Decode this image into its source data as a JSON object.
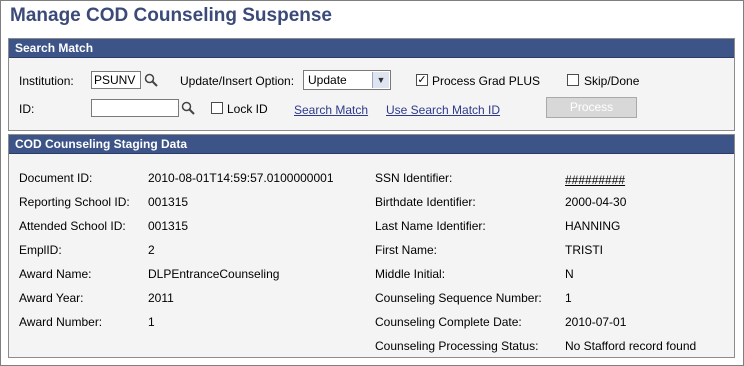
{
  "page": {
    "title": "Manage COD Counseling Suspense"
  },
  "search_match": {
    "header": "Search Match",
    "institution_label": "Institution:",
    "institution_value": "PSUNV",
    "update_option_label": "Update/Insert Option:",
    "update_option_value": "Update",
    "process_grad_plus_label": "Process Grad PLUS",
    "process_grad_plus_checked": "✓",
    "skip_done_label": "Skip/Done",
    "id_label": "ID:",
    "id_value": "",
    "lock_id_label": "Lock ID",
    "search_match_link": "Search Match",
    "use_search_match_id_link": "Use Search Match ID",
    "process_button": "Process"
  },
  "staging": {
    "header": "COD Counseling Staging Data",
    "left": [
      {
        "label": "Document ID:",
        "value": "2010-08-01T14:59:57.0100000001"
      },
      {
        "label": "Reporting School ID:",
        "value": "001315"
      },
      {
        "label": "Attended School ID:",
        "value": "001315"
      },
      {
        "label": "EmplID:",
        "value": "2"
      },
      {
        "label": "Award Name:",
        "value": "DLPEntranceCounseling"
      },
      {
        "label": "Award Year:",
        "value": "2011"
      },
      {
        "label": "Award Number:",
        "value": "1"
      }
    ],
    "right": [
      {
        "label": "SSN Identifier:",
        "value": "#########"
      },
      {
        "label": "Birthdate Identifier:",
        "value": "2000-04-30"
      },
      {
        "label": "Last Name Identifier:",
        "value": "HANNING"
      },
      {
        "label": "First Name:",
        "value": "TRISTI"
      },
      {
        "label": "Middle Initial:",
        "value": "N"
      },
      {
        "label": "Counseling Sequence Number:",
        "value": "1"
      },
      {
        "label": "Counseling Complete Date:",
        "value": "2010-07-01"
      },
      {
        "label": "Counseling Processing Status:",
        "value": "No Stafford record found"
      }
    ]
  },
  "icons": {
    "lookup": "magnifier-icon",
    "dropdown": "chevron-down-icon",
    "check": "checkmark-icon"
  },
  "colors": {
    "title": "#3b4a78",
    "panel_header_bg": "#3d5488",
    "link": "#2d3a8c",
    "disabled_button": "#d8d8d8"
  }
}
